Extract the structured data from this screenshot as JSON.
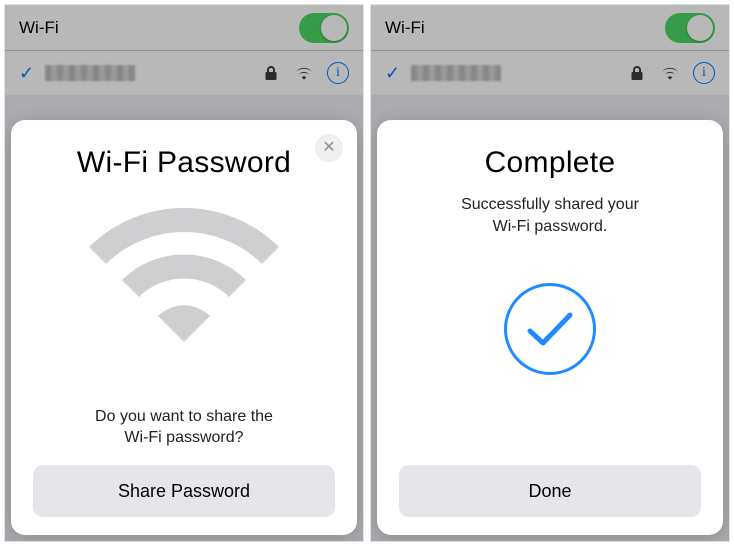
{
  "left": {
    "setting_label": "Wi-Fi",
    "toggle_on": true,
    "sheet": {
      "title": "Wi-Fi Password",
      "prompt": "Do you want to share the\nWi-Fi password?",
      "action": "Share Password"
    }
  },
  "right": {
    "setting_label": "Wi-Fi",
    "toggle_on": true,
    "sheet": {
      "title": "Complete",
      "subtitle": "Successfully shared your\nWi-Fi password.",
      "action": "Done"
    }
  },
  "colors": {
    "accent_blue": "#007aff",
    "toggle_green": "#4cd964"
  }
}
